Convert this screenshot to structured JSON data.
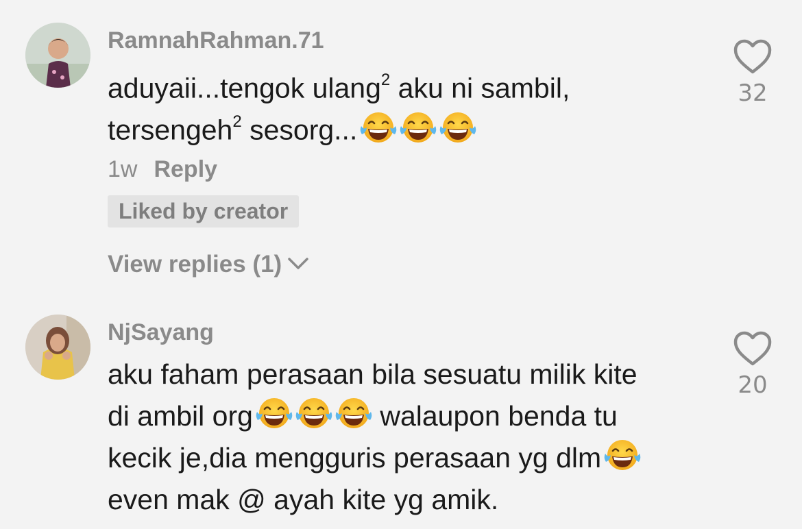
{
  "comments": [
    {
      "username": "RamnahRahman.71",
      "lines": [
        {
          "text": "aduyaii...tengok ulang",
          "sup": "2",
          "tail": " aku ni sambil,",
          "emojis": 0
        },
        {
          "text": "tersengeh",
          "sup": "2",
          "tail": " sesorg...",
          "emojis": 3
        }
      ],
      "time": "1w",
      "reply_label": "Reply",
      "liked_badge": "Liked by creator",
      "view_replies": "View replies (1)",
      "like_count": "32"
    },
    {
      "username": "NjSayang",
      "lines": [
        {
          "text": "aku faham perasaan bila sesuatu milik kite"
        },
        {
          "text": "di ambil org",
          "emojis_after_text": 3,
          "tail": " walaupon benda tu"
        },
        {
          "text": "kecik je,dia mengguris perasaan yg dlm",
          "emojis_after_text": 1
        },
        {
          "text": "even mak @ ayah kite yg amik."
        }
      ],
      "like_count": "20"
    }
  ],
  "icons": {
    "like": "heart-outline-icon",
    "emoji": "face-with-tears-of-joy-emoji",
    "expand": "chevron-down-icon"
  },
  "colors": {
    "background": "#f3f3f3",
    "muted_text": "#8a8a8a",
    "body_text": "#1a1a1a",
    "badge_bg": "#e3e3e3"
  }
}
